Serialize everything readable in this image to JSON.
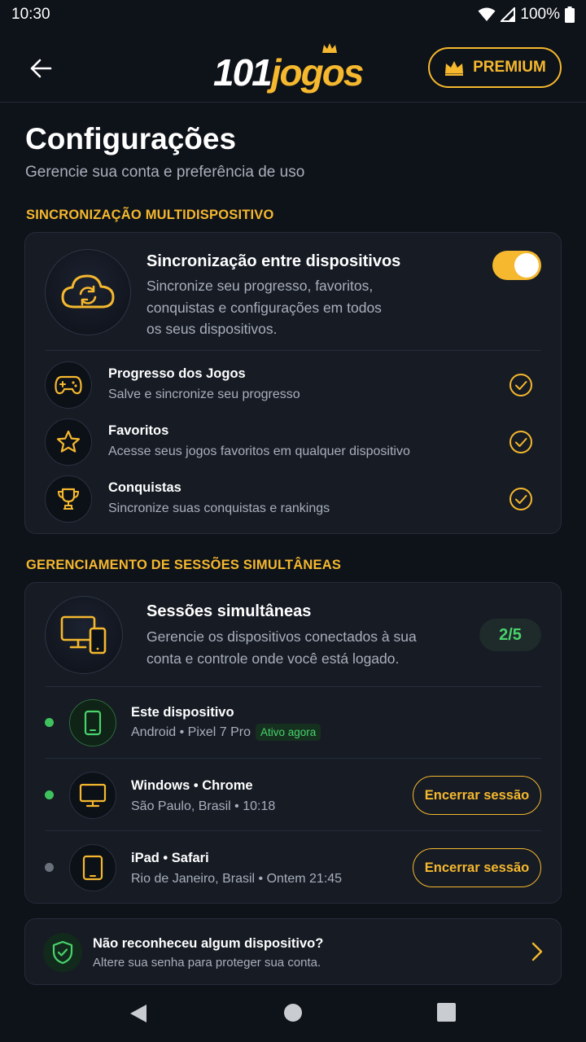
{
  "status": {
    "time": "10:30",
    "battery": "100%"
  },
  "header": {
    "logo_white": "101",
    "logo_yellow": "jogos",
    "premium_label": "PREMIUM"
  },
  "page": {
    "title": "Configurações",
    "subtitle": "Gerencie sua conta e preferência de uso"
  },
  "sync": {
    "section_label": "SINCRONIZAÇÃO MULTIDISPOSITIVO",
    "title": "Sincronização entre dispositivos",
    "desc_lines": [
      "Sincronize seu progresso, favoritos,",
      "conquistas e configurações em todos",
      "os seus dispositivos."
    ],
    "enabled": true,
    "features": [
      {
        "title": "Progresso dos Jogos",
        "desc": "Salve e sincronize seu progresso",
        "icon": "gamepad-icon"
      },
      {
        "title": "Favoritos",
        "desc": "Acesse seus jogos favoritos em qualquer dispositivo",
        "icon": "star-icon"
      },
      {
        "title": "Conquistas",
        "desc": "Sincronize suas conquistas e rankings",
        "icon": "trophy-icon"
      }
    ]
  },
  "sessions": {
    "section_label": "GERENCIAMENTO DE SESSÕES SIMULTÂNEAS",
    "title": "Sessões simultâneas",
    "desc_lines": [
      "Gerencie os dispositivos conectados à sua",
      "conta e controle onde você está logado."
    ],
    "count": "2/5",
    "devices": [
      {
        "name": "Este dispositivo",
        "meta": "Android • Pixel 7 Pro",
        "badge": "Ativo agora",
        "status_color": "#3fc25e"
      },
      {
        "name": "Windows • Chrome",
        "meta": "São Paulo, Brasil • 10:18",
        "action": "Encerrar sessão",
        "status_color": "#3fc25e"
      },
      {
        "name": "iPad • Safari",
        "meta": "Rio de Janeiro, Brasil • Ontem 21:45",
        "action": "Encerrar sessão",
        "status_color": "#6b717c"
      }
    ]
  },
  "security": {
    "title": "Não reconheceu algum dispositivo?",
    "desc": "Altere sua senha para proteger sua conta."
  },
  "colors": {
    "accent": "#f5b82e",
    "success": "#48d36c",
    "background": "#0e1219",
    "card": "#161b24"
  }
}
